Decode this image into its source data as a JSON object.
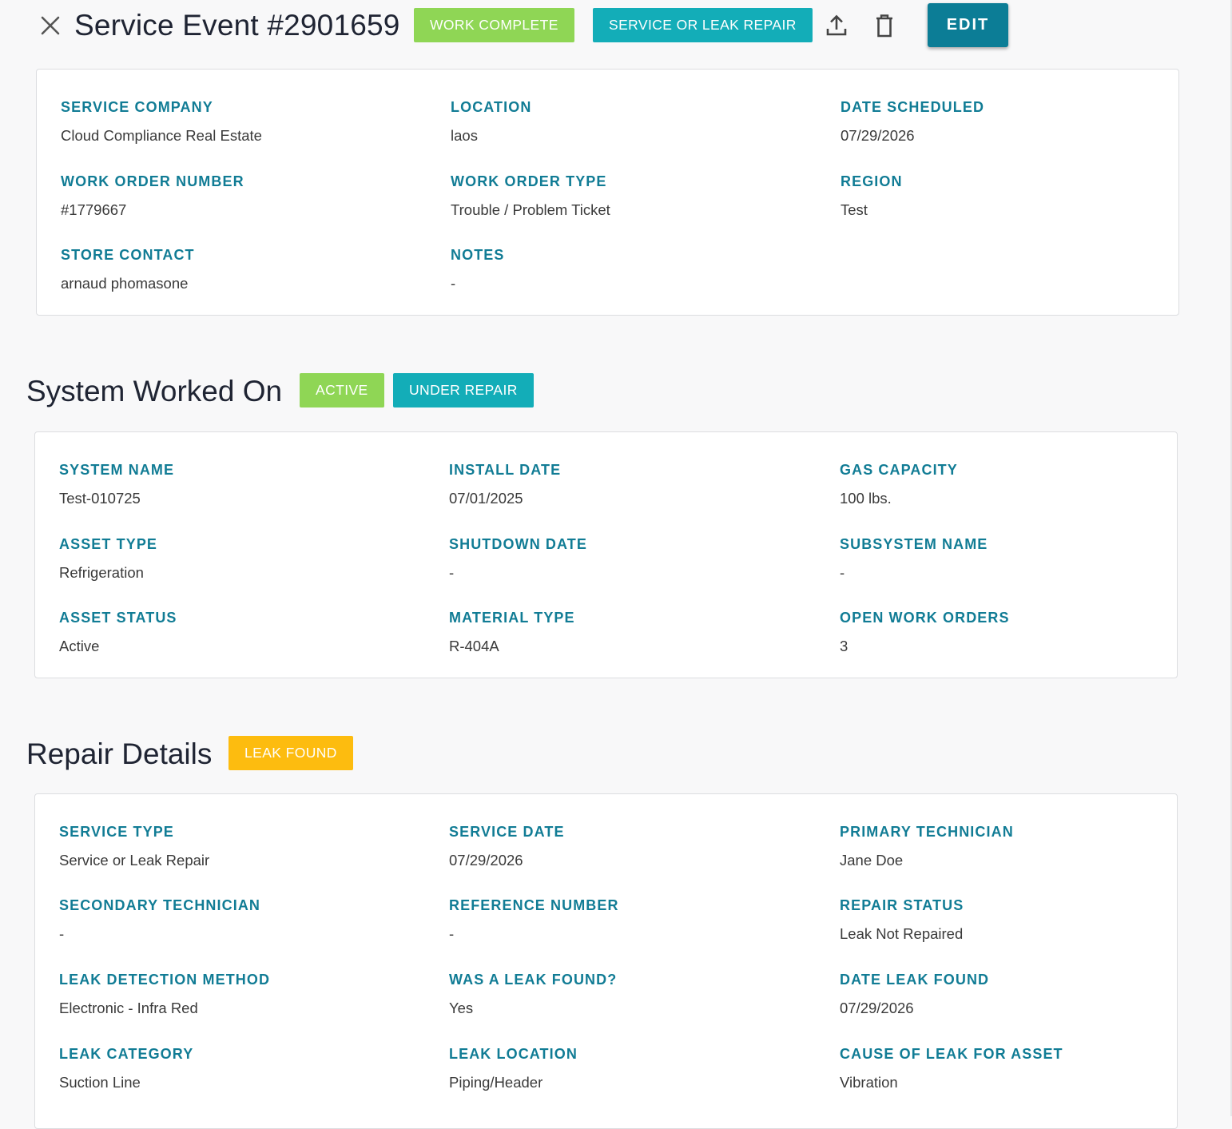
{
  "header": {
    "title": "Service Event #2901659",
    "badges": [
      {
        "label": "WORK COMPLETE",
        "color": "#8fd655"
      },
      {
        "label": "SERVICE OR LEAK REPAIR",
        "color": "#13adb8"
      }
    ],
    "edit_label": "EDIT"
  },
  "event_details": {
    "fields": [
      {
        "label": "SERVICE COMPANY",
        "value": "Cloud Compliance Real Estate"
      },
      {
        "label": "LOCATION",
        "value": "laos"
      },
      {
        "label": "DATE SCHEDULED",
        "value": "07/29/2026"
      },
      {
        "label": "WORK ORDER NUMBER",
        "value": "#1779667"
      },
      {
        "label": "WORK ORDER TYPE",
        "value": "Trouble / Problem Ticket"
      },
      {
        "label": "REGION",
        "value": "Test"
      },
      {
        "label": "STORE CONTACT",
        "value": "arnaud phomasone"
      },
      {
        "label": "NOTES",
        "value": "-"
      }
    ]
  },
  "system": {
    "title": "System Worked On",
    "badges": [
      {
        "label": "ACTIVE",
        "color": "#8fd655"
      },
      {
        "label": "UNDER REPAIR",
        "color": "#13adb8"
      }
    ],
    "fields": [
      {
        "label": "SYSTEM NAME",
        "value": "Test-010725"
      },
      {
        "label": "INSTALL DATE",
        "value": "07/01/2025"
      },
      {
        "label": "GAS CAPACITY",
        "value": "100 lbs."
      },
      {
        "label": "ASSET TYPE",
        "value": "Refrigeration"
      },
      {
        "label": "SHUTDOWN DATE",
        "value": "-"
      },
      {
        "label": "SUBSYSTEM NAME",
        "value": "-"
      },
      {
        "label": "ASSET STATUS",
        "value": "Active"
      },
      {
        "label": "MATERIAL TYPE",
        "value": "R-404A"
      },
      {
        "label": "OPEN WORK ORDERS",
        "value": "3"
      }
    ]
  },
  "repair": {
    "title": "Repair Details",
    "badges": [
      {
        "label": "LEAK FOUND",
        "color": "#fdbc0f"
      }
    ],
    "fields": [
      {
        "label": "SERVICE TYPE",
        "value": "Service or Leak Repair"
      },
      {
        "label": "SERVICE DATE",
        "value": "07/29/2026"
      },
      {
        "label": "PRIMARY TECHNICIAN",
        "value": "Jane Doe"
      },
      {
        "label": "SECONDARY TECHNICIAN",
        "value": "-"
      },
      {
        "label": "REFERENCE NUMBER",
        "value": "-"
      },
      {
        "label": "REPAIR STATUS",
        "value": "Leak Not Repaired"
      },
      {
        "label": "LEAK DETECTION METHOD",
        "value": "Electronic - Infra Red"
      },
      {
        "label": "WAS A LEAK FOUND?",
        "value": "Yes"
      },
      {
        "label": "DATE LEAK FOUND",
        "value": "07/29/2026"
      },
      {
        "label": "LEAK CATEGORY",
        "value": "Suction Line"
      },
      {
        "label": "LEAK LOCATION",
        "value": "Piping/Header"
      },
      {
        "label": "CAUSE OF LEAK FOR ASSET",
        "value": "Vibration"
      }
    ]
  }
}
